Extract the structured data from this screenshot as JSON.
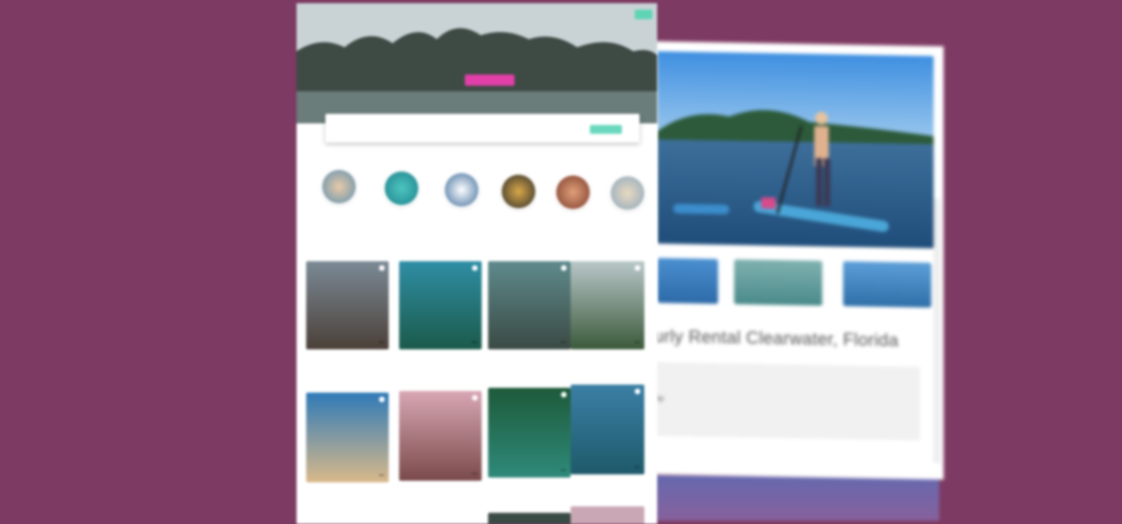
{
  "back_window": {
    "listing_title": "urly Rental Clearwater, Florida",
    "panel_text": "ay"
  },
  "front_window": {
    "hero": {
      "title": "",
      "cta_label": "",
      "corner_button": ""
    },
    "search": {
      "location_placeholder": "",
      "date_placeholder": "",
      "filters": [
        "",
        "",
        "",
        ""
      ],
      "button_label": ""
    },
    "sections": {
      "collections_title": "",
      "row1_title": "",
      "row2_title": "",
      "row3_title": ""
    },
    "collections": [
      {
        "label": "",
        "icon": "person-avatar-icon"
      },
      {
        "label": "",
        "icon": "water-icon"
      },
      {
        "label": "",
        "icon": "boat-icon"
      },
      {
        "label": "",
        "icon": "animal-icon"
      },
      {
        "label": "",
        "icon": "person-avatar-icon"
      },
      {
        "label": "",
        "icon": "beach-icon"
      }
    ],
    "row1_cards": [
      {
        "title": "",
        "subtitle": "",
        "price": ""
      },
      {
        "title": "",
        "subtitle": "",
        "price": ""
      },
      {
        "title": "",
        "subtitle": "",
        "price": ""
      },
      {
        "title": "",
        "subtitle": "",
        "price": ""
      }
    ],
    "row2_cards": [
      {
        "title": "",
        "subtitle": "",
        "price": ""
      },
      {
        "title": "",
        "subtitle": "",
        "price": ""
      },
      {
        "title": "",
        "subtitle": "",
        "price": ""
      },
      {
        "title": "",
        "subtitle": "",
        "price": ""
      }
    ]
  },
  "colors": {
    "background": "#7d3a62",
    "cta_pink": "#e23fa8",
    "accent_mint": "#5fd4b5"
  }
}
